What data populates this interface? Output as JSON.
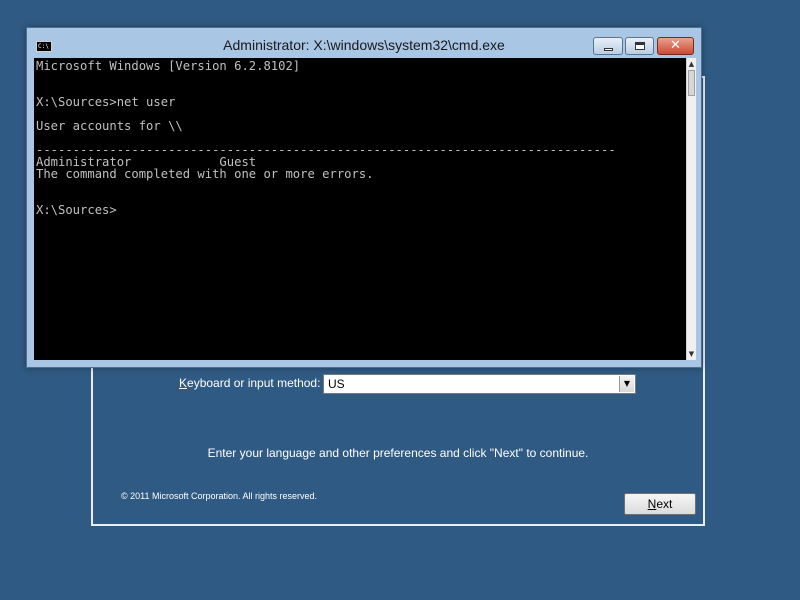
{
  "setup": {
    "keyboard_label_prefix": "",
    "keyboard_label_underlined": "K",
    "keyboard_label_rest": "eyboard or input method:",
    "keyboard_value": "US",
    "instruction": "Enter your language and other preferences and click \"Next\" to continue.",
    "copyright": "© 2011 Microsoft Corporation. All rights reserved.",
    "next_underlined": "N",
    "next_rest": "ext"
  },
  "cmd": {
    "icon_text": "C:\\",
    "title": "Administrator: X:\\windows\\system32\\cmd.exe",
    "close_glyph": "✕",
    "lines": [
      "Microsoft Windows [Version 6.2.8102]",
      "",
      "X:\\Sources>net user",
      "",
      "User accounts for \\\\",
      "",
      "-------------------------------------------------------------------------------",
      "Administrator            Guest",
      "The command completed with one or more errors.",
      "",
      "",
      "X:\\Sources>"
    ],
    "scroll_up": "▲",
    "scroll_down": "▼"
  }
}
